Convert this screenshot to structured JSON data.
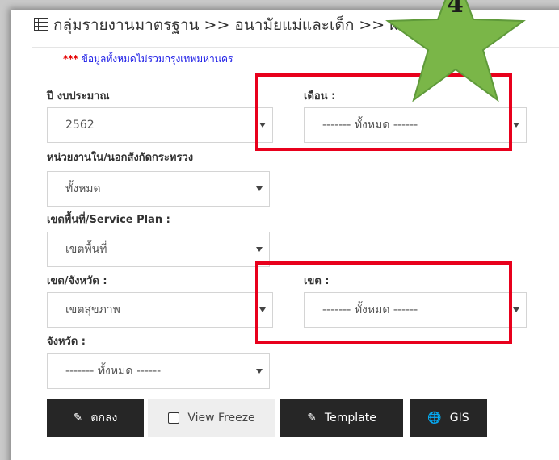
{
  "header": {
    "title": "กลุ่มรายงานมาตรฐาน >> อนามัยแม่และเด็ก >> ผลก"
  },
  "notice": {
    "stars": "***",
    "text": " ข้อมูลทั้งหมดไม่รวมกรุงเทพมหานคร"
  },
  "filters": {
    "budget_year": {
      "label": "ปี งบประมาณ",
      "value": "2562"
    },
    "month": {
      "label": "เดือน :",
      "value": "------- ทั้งหมด ------"
    },
    "agency": {
      "label": "หน่วยงานใน/นอกสังกัดกระทรวง",
      "value": "ทั้งหมด"
    },
    "area": {
      "label": "เขตพื้นที่/Service Plan :",
      "value": "เขตพื้นที่"
    },
    "region_province": {
      "label": "เขต/จังหวัด :",
      "value": "เขตสุขภาพ"
    },
    "region": {
      "label": "เขต :",
      "value": "------- ทั้งหมด ------"
    },
    "province": {
      "label": "จังหวัด :",
      "value": "------- ทั้งหมด ------"
    }
  },
  "buttons": {
    "ok": "ตกลง",
    "view_freeze": "View Freeze",
    "template": "Template",
    "gis": "GIS"
  },
  "annotation": {
    "step_number": "4",
    "star_color": "#7ab648",
    "highlight_color": "#e8001c"
  },
  "icons": {
    "table": "table-icon",
    "edit": "edit-icon",
    "checkbox": "checkbox-icon",
    "globe": "globe-icon",
    "caret": "caret-down-icon"
  }
}
